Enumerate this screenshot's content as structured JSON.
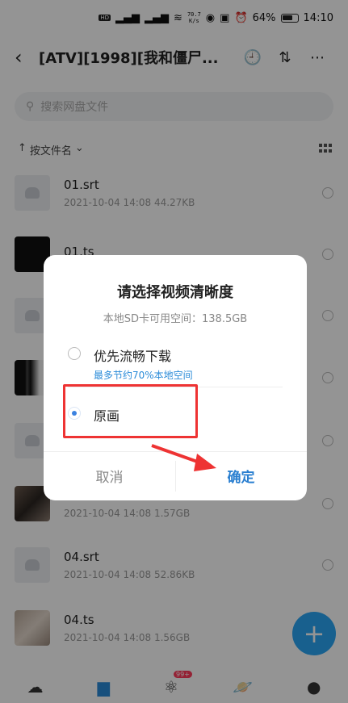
{
  "status_bar": {
    "net_speed_top": "70.7",
    "net_speed_unit": "K/s",
    "battery": "64%",
    "time": "14:10"
  },
  "header": {
    "title": "[ATV][1998][我和僵尸..."
  },
  "search": {
    "placeholder": "搜索网盘文件"
  },
  "sort": {
    "label": "按文件名"
  },
  "files": [
    {
      "name": "01.srt",
      "meta": "2021-10-04  14:08  44.27KB"
    },
    {
      "name": "01.ts",
      "meta": ""
    },
    {
      "name": "",
      "meta": ""
    },
    {
      "name": "",
      "meta": ""
    },
    {
      "name": "",
      "meta": ""
    },
    {
      "name": "",
      "meta": "2021-10-04  14:08  1.57GB"
    },
    {
      "name": "04.srt",
      "meta": "2021-10-04  14:08  52.86KB"
    },
    {
      "name": "04.ts",
      "meta": "2021-10-04  14:08  1.56GB"
    }
  ],
  "bottom_nav": {
    "badge": "99+"
  },
  "dialog": {
    "title": "请选择视频清晰度",
    "subtitle": "本地SD卡可用空间：138.5GB",
    "option1_label": "优先流畅下载",
    "option1_note": "最多节约70%本地空间",
    "option2_label": "原画",
    "option2_selected": true,
    "cancel": "取消",
    "confirm": "确定"
  },
  "colors": {
    "accent": "#2a7fd0",
    "highlight": "#e33333",
    "fab": "#2aa5f5"
  }
}
